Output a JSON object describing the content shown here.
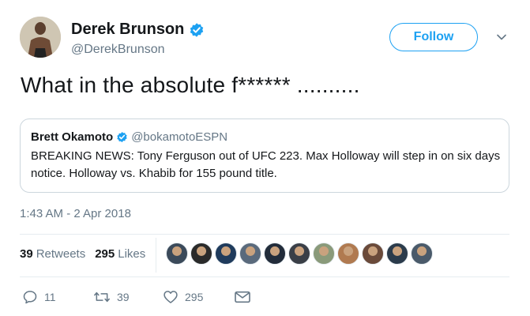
{
  "author": {
    "name": "Derek Brunson",
    "handle": "@DerekBrunson",
    "follow_label": "Follow"
  },
  "tweet": {
    "text": "What in the absolute f****** ..........",
    "timestamp": "1:43 AM - 2 Apr 2018"
  },
  "quoted_tweet": {
    "name": "Brett Okamoto",
    "handle": "@bokamotoESPN",
    "text": "BREAKING NEWS: Tony Ferguson out of UFC 223. Max Holloway will step in on six days notice. Holloway vs. Khabib for 155 pound title."
  },
  "stats": {
    "retweets_count": "39",
    "retweets_label": "Retweets",
    "likes_count": "295",
    "likes_label": "Likes"
  },
  "liker_avatars": [
    "#3b4a5a",
    "#2a2a2a",
    "#1f3b5c",
    "#5a6a7c",
    "#222c3a",
    "#3a3f47",
    "#8a9a7a",
    "#b07a50",
    "#6a4a3a",
    "#2b3b4b",
    "#4a5a6a"
  ],
  "actions": {
    "replies": "11",
    "retweets": "39",
    "likes": "295"
  },
  "colors": {
    "accent": "#1da1f2",
    "muted": "#657786",
    "text": "#14171a",
    "border": "#ccd6dd"
  },
  "icons": {
    "verified": "verified-badge-icon",
    "chevron": "chevron-down-icon",
    "reply": "reply-icon",
    "retweet": "retweet-icon",
    "like": "heart-icon",
    "dm": "envelope-icon"
  }
}
